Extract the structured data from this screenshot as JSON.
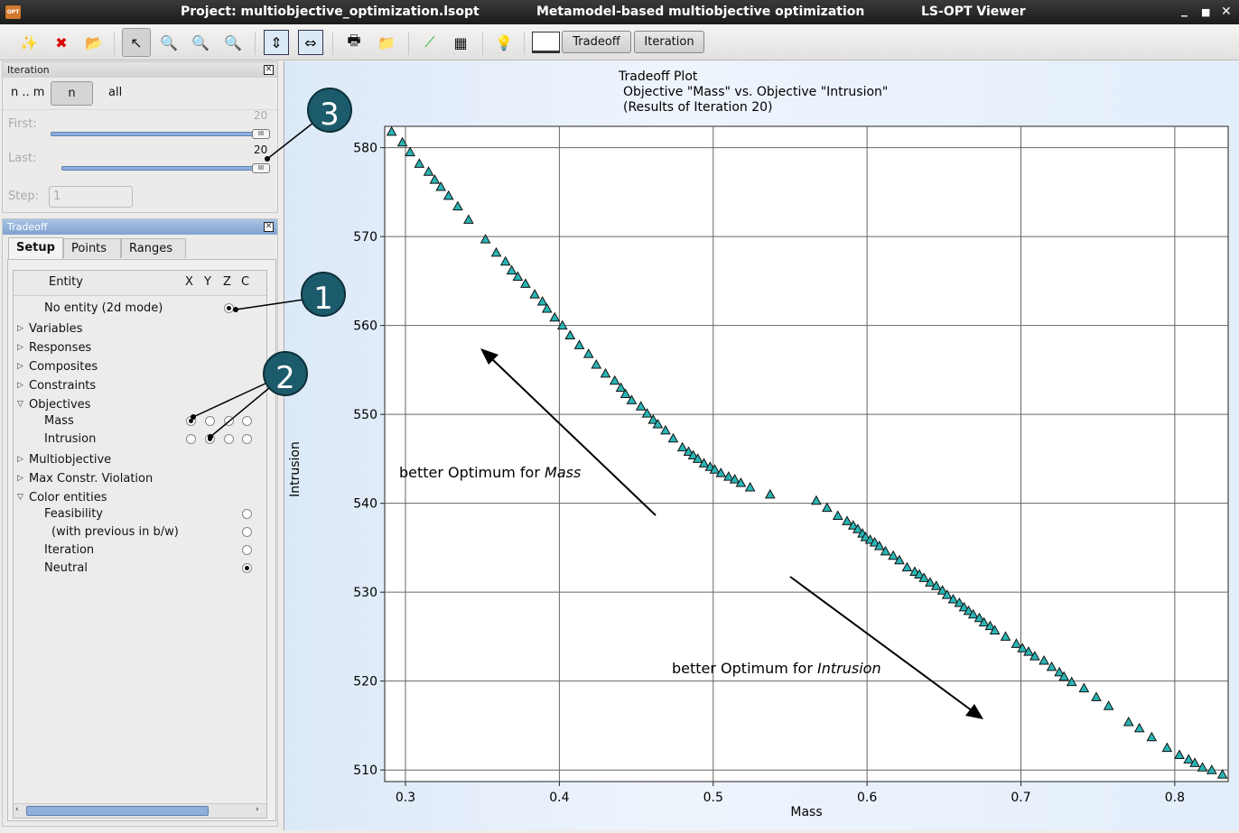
{
  "window": {
    "title_project": "Project: multiobjective_optimization.lsopt",
    "title_mode": "Metamodel-based multiobjective optimization",
    "title_app": "LS-OPT Viewer",
    "app_icon": "OPT"
  },
  "toolbar": {
    "icons": [
      "new-plot-icon",
      "delete-plot-icon",
      "open-folder-icon",
      "pointer-icon",
      "zoom-in-icon",
      "zoom-out-icon",
      "zoom-reset-icon",
      "fit-vertical-icon",
      "fit-horizontal-icon",
      "print-icon",
      "export-icon",
      "link-points-icon",
      "table-icon",
      "lightbulb-icon"
    ],
    "tradeoff": "Tradeoff",
    "iteration": "Iteration"
  },
  "iteration_panel": {
    "title": "Iteration",
    "mode_range": "n .. m",
    "mode_n": "n",
    "mode_all": "all",
    "first_label": "First:",
    "first_value": "20",
    "last_label": "Last:",
    "last_value": "20",
    "step_label": "Step:",
    "step_value": "1",
    "slider_fraction": 1.0
  },
  "tradeoff_panel": {
    "title": "Tradeoff",
    "tabs": [
      "Setup",
      "Points",
      "Ranges"
    ],
    "columns": {
      "entity": "Entity",
      "x": "X",
      "y": "Y",
      "z": "Z",
      "c": "C"
    },
    "rows": [
      {
        "label": "No entity (2d mode)",
        "indent": 2,
        "radios": {
          "z": true
        }
      },
      {
        "label": "Variables",
        "indent": 0,
        "expander": "collapsed"
      },
      {
        "label": "Responses",
        "indent": 0,
        "expander": "collapsed"
      },
      {
        "label": "Composites",
        "indent": 0,
        "expander": "collapsed"
      },
      {
        "label": "Constraints",
        "indent": 0,
        "expander": "collapsed"
      },
      {
        "label": "Objectives",
        "indent": 0,
        "expander": "expanded"
      },
      {
        "label": "Mass",
        "indent": 2,
        "radios": {
          "x": true,
          "y": false,
          "z": false,
          "c": false
        }
      },
      {
        "label": "Intrusion",
        "indent": 2,
        "radios": {
          "x": false,
          "y": true,
          "z": false,
          "c": false
        }
      },
      {
        "label": "Multiobjective",
        "indent": 0,
        "expander": "collapsed"
      },
      {
        "label": "Max Constr. Violation",
        "indent": 0,
        "expander": "collapsed"
      },
      {
        "label": "Color entities",
        "indent": 0,
        "expander": "expanded"
      },
      {
        "label": "Feasibility",
        "indent": 2,
        "radios": {
          "c": false
        }
      },
      {
        "label": "(with previous in b/w)",
        "indent": 3,
        "radios": {
          "c": false
        }
      },
      {
        "label": "Iteration",
        "indent": 2,
        "radios": {
          "c": false
        }
      },
      {
        "label": "Neutral",
        "indent": 2,
        "radios": {
          "c": true
        }
      }
    ]
  },
  "callouts": [
    "1",
    "2",
    "3"
  ],
  "chart_data": {
    "type": "scatter",
    "title": "Tradeoff Plot",
    "subtitle": "Objective \"Mass\" vs. Objective \"Intrusion\"",
    "subtitle2": "(Results of Iteration 20)",
    "xlabel": "Mass",
    "ylabel": "Intrusion",
    "xlim": [
      0.2865,
      0.8347
    ],
    "ylim": [
      508.7,
      582.4
    ],
    "xticks": [
      "0.3",
      "0.4",
      "0.5",
      "0.6",
      "0.7",
      "0.8"
    ],
    "yticks": [
      "510",
      "520",
      "530",
      "540",
      "550",
      "560",
      "570",
      "580"
    ],
    "grid": true,
    "marker": "triangle",
    "marker_color": "#2ab5b5",
    "annotations": [
      {
        "text": "better Optimum for ",
        "emph": "Mass"
      },
      {
        "text": "better Optimum for ",
        "emph": "Intrusion"
      }
    ],
    "points": [
      [
        0.291,
        581.8
      ],
      [
        0.298,
        580.6
      ],
      [
        0.303,
        579.5
      ],
      [
        0.309,
        578.2
      ],
      [
        0.315,
        577.3
      ],
      [
        0.319,
        576.4
      ],
      [
        0.323,
        575.6
      ],
      [
        0.328,
        574.6
      ],
      [
        0.334,
        573.4
      ],
      [
        0.341,
        571.9
      ],
      [
        0.352,
        569.7
      ],
      [
        0.359,
        568.2
      ],
      [
        0.365,
        567.2
      ],
      [
        0.369,
        566.2
      ],
      [
        0.373,
        565.5
      ],
      [
        0.378,
        564.7
      ],
      [
        0.384,
        563.5
      ],
      [
        0.389,
        562.7
      ],
      [
        0.392,
        561.9
      ],
      [
        0.397,
        560.9
      ],
      [
        0.402,
        560.0
      ],
      [
        0.407,
        558.9
      ],
      [
        0.413,
        557.8
      ],
      [
        0.419,
        556.8
      ],
      [
        0.424,
        555.6
      ],
      [
        0.43,
        554.6
      ],
      [
        0.436,
        553.8
      ],
      [
        0.44,
        553.0
      ],
      [
        0.443,
        552.3
      ],
      [
        0.447,
        551.6
      ],
      [
        0.453,
        550.9
      ],
      [
        0.457,
        550.1
      ],
      [
        0.461,
        549.4
      ],
      [
        0.464,
        548.9
      ],
      [
        0.469,
        548.2
      ],
      [
        0.474,
        547.3
      ],
      [
        0.48,
        546.3
      ],
      [
        0.484,
        545.8
      ],
      [
        0.487,
        545.4
      ],
      [
        0.49,
        545.0
      ],
      [
        0.494,
        544.5
      ],
      [
        0.498,
        544.1
      ],
      [
        0.501,
        543.8
      ],
      [
        0.505,
        543.4
      ],
      [
        0.51,
        543.0
      ],
      [
        0.514,
        542.7
      ],
      [
        0.518,
        542.3
      ],
      [
        0.524,
        541.8
      ],
      [
        0.537,
        541.0
      ],
      [
        0.567,
        540.3
      ],
      [
        0.574,
        539.5
      ],
      [
        0.581,
        538.6
      ],
      [
        0.587,
        538.0
      ],
      [
        0.591,
        537.5
      ],
      [
        0.594,
        537.1
      ],
      [
        0.597,
        536.6
      ],
      [
        0.599,
        536.2
      ],
      [
        0.602,
        535.9
      ],
      [
        0.605,
        535.6
      ],
      [
        0.608,
        535.2
      ],
      [
        0.612,
        534.6
      ],
      [
        0.617,
        534.1
      ],
      [
        0.621,
        533.6
      ],
      [
        0.626,
        532.8
      ],
      [
        0.631,
        532.3
      ],
      [
        0.634,
        532.0
      ],
      [
        0.637,
        531.6
      ],
      [
        0.641,
        531.1
      ],
      [
        0.645,
        530.7
      ],
      [
        0.649,
        530.2
      ],
      [
        0.652,
        529.7
      ],
      [
        0.656,
        529.2
      ],
      [
        0.66,
        528.8
      ],
      [
        0.663,
        528.3
      ],
      [
        0.666,
        527.9
      ],
      [
        0.669,
        527.5
      ],
      [
        0.673,
        527.1
      ],
      [
        0.676,
        526.6
      ],
      [
        0.68,
        526.2
      ],
      [
        0.683,
        525.7
      ],
      [
        0.69,
        525.0
      ],
      [
        0.697,
        524.2
      ],
      [
        0.701,
        523.7
      ],
      [
        0.705,
        523.3
      ],
      [
        0.709,
        522.8
      ],
      [
        0.715,
        522.3
      ],
      [
        0.72,
        521.6
      ],
      [
        0.725,
        521.0
      ],
      [
        0.728,
        520.5
      ],
      [
        0.733,
        519.9
      ],
      [
        0.741,
        519.2
      ],
      [
        0.749,
        518.2
      ],
      [
        0.757,
        517.2
      ],
      [
        0.77,
        515.4
      ],
      [
        0.777,
        514.7
      ],
      [
        0.785,
        513.7
      ],
      [
        0.795,
        512.5
      ],
      [
        0.803,
        511.7
      ],
      [
        0.809,
        511.2
      ],
      [
        0.813,
        510.8
      ],
      [
        0.818,
        510.3
      ],
      [
        0.824,
        510.0
      ],
      [
        0.831,
        509.5
      ]
    ]
  }
}
